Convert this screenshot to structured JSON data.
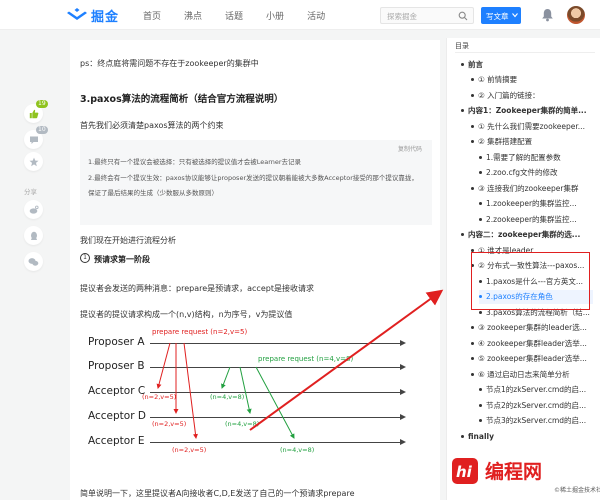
{
  "header": {
    "logo_text": "掘金",
    "nav": [
      "首页",
      "沸点",
      "话题",
      "小册",
      "活动"
    ],
    "search_placeholder": "探索掘金",
    "write_label": "写文章"
  },
  "sidebar_actions": {
    "like_count": "19",
    "comment_count": "10",
    "share_label": "分享"
  },
  "article": {
    "ps_line": "ps：终点庭将需问题不存在于zookeeper的集群中",
    "heading": "3.paxos算法的流程简析（结合官方流程说明）",
    "intro": "首先我们必须清楚paxos算法的两个约束",
    "code": {
      "copy_label": "复制代码",
      "lines": [
        "1.最终只有一个提议会被选择：只有被选择的提议值才会被Learner去记录",
        "2.最终会有一个提议生效：paxos协议能够让proposer发送的提议朝着能被大多数Acceptor接受的那个提议靠拢，",
        "保证了最后结果的生成（少数服从多数原则）"
      ]
    },
    "analysis_line": "我们现在开始进行流程分析",
    "step": {
      "number": "1",
      "title": "预请求第一阶段"
    },
    "line_a": "提议者会发送的两种消息：prepare是预请求，accept是接收请求",
    "line_b": "提议者的提议请求构成一个(n,v)结构，n为序号，v为提议值",
    "bottom_line": "简单说明一下，这里提议者A向接收者C,D,E发送了自己的一个预请求prepare"
  },
  "diagram": {
    "actors": [
      "Proposer A",
      "Proposer B",
      "Acceptor C",
      "Acceptor D",
      "Acceptor E"
    ],
    "prepare_a": "prepare request (n=2,v=5)",
    "prepare_b": "prepare request (n=4,v=8)",
    "resp_a": [
      "(n=2,v=5)",
      "(n=2,v=5)",
      "(n=2,v=5)"
    ],
    "resp_b": [
      "(n=4,v=8)",
      "(n=4,v=8)",
      "(n=4,v=8)"
    ]
  },
  "toc": {
    "title": "目录",
    "items": [
      {
        "level": 1,
        "label": "前言"
      },
      {
        "level": 2,
        "label": "① 前情摘要"
      },
      {
        "level": 2,
        "label": "② 入门篇的链接："
      },
      {
        "level": 1,
        "label": "内容1：Zookeeper集群的简单..."
      },
      {
        "level": 2,
        "label": "① 先什么我们需要zookeeper..."
      },
      {
        "level": 2,
        "label": "② 集群搭建配置"
      },
      {
        "level": 3,
        "label": "1.需要了解的配置参数"
      },
      {
        "level": 3,
        "label": "2.zoo.cfg文件的修改"
      },
      {
        "level": 2,
        "label": "③ 连接我们的zookeeper集群"
      },
      {
        "level": 3,
        "label": "1.zookeeper的集群监控..."
      },
      {
        "level": 3,
        "label": "2.zookeeper的集群监控..."
      },
      {
        "level": 1,
        "label": "内容二：zookeeper集群的选..."
      },
      {
        "level": 2,
        "label": "① 谁才是leader"
      },
      {
        "level": 2,
        "label": "② 分布式一致性算法---paxos..."
      },
      {
        "level": 3,
        "label": "1.paxos是什么---官方英文..."
      },
      {
        "level": 3,
        "label": "2.paxos的存在角色",
        "active": true
      },
      {
        "level": 3,
        "label": "3.paxos算法的流程简析（结..."
      },
      {
        "level": 2,
        "label": "③ zookeeper集群的leader选..."
      },
      {
        "level": 2,
        "label": "④ zookeeper集群leader选举..."
      },
      {
        "level": 2,
        "label": "⑤ zookeeper集群leader选举..."
      },
      {
        "level": 2,
        "label": "⑥ 通过启动日志来简单分析"
      },
      {
        "level": 3,
        "label": "节点1的zkServer.cmd的启..."
      },
      {
        "level": 3,
        "label": "节点2的zkServer.cmd的启..."
      },
      {
        "level": 3,
        "label": "节点3的zkServer.cmd的启..."
      },
      {
        "level": 1,
        "label": "finally"
      }
    ]
  },
  "watermark": {
    "name": "编程网",
    "sub": "©稀土掘金技术社区"
  },
  "colors": {
    "accent": "#1e80ff",
    "annotation_red": "#e02020",
    "annotation_green": "#22a040"
  }
}
